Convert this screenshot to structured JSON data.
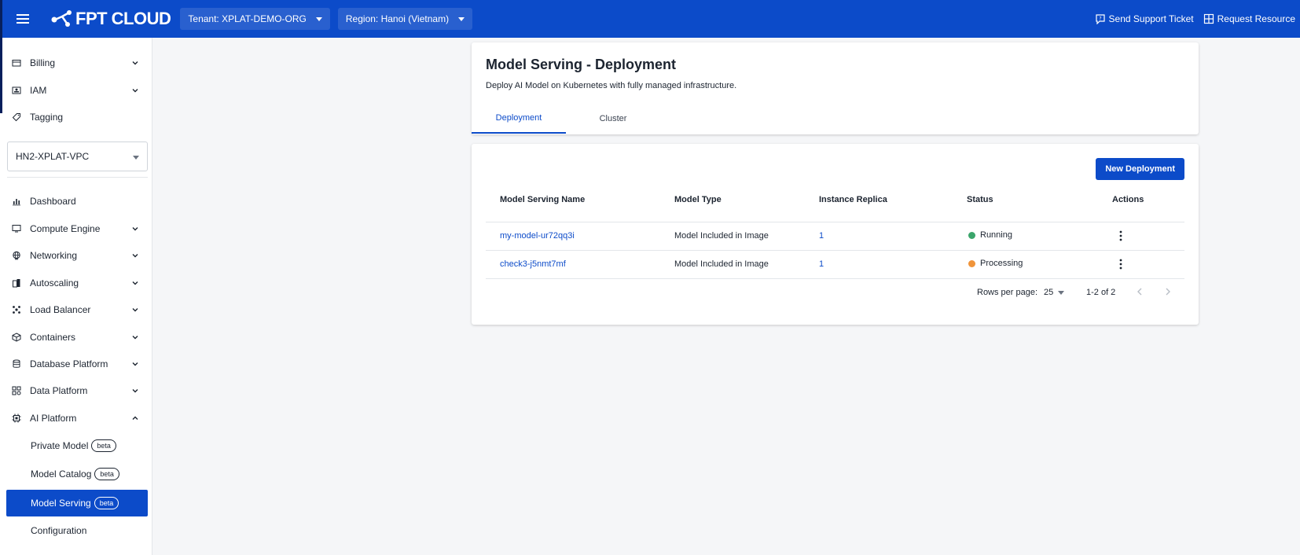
{
  "topbar": {
    "logo_text": "FPT CLOUD",
    "tenant": "Tenant: XPLAT-DEMO-ORG",
    "region": "Region: Hanoi (Vietnam)",
    "support": "Send Support Ticket",
    "request": "Request Resource"
  },
  "sidebar": {
    "top_items": [
      {
        "label": "Billing",
        "icon": "wallet-icon"
      },
      {
        "label": "IAM",
        "icon": "id-card-icon"
      },
      {
        "label": "Tagging",
        "icon": "tag-icon"
      }
    ],
    "vpc": "HN2-XPLAT-VPC",
    "items": [
      {
        "label": "Dashboard",
        "icon": "bar-chart-icon"
      },
      {
        "label": "Compute Engine",
        "icon": "monitor-icon"
      },
      {
        "label": "Networking",
        "icon": "globe-icon"
      },
      {
        "label": "Autoscaling",
        "icon": "building-icon"
      },
      {
        "label": "Load Balancer",
        "icon": "load-balancer-icon"
      },
      {
        "label": "Containers",
        "icon": "box-icon"
      },
      {
        "label": "Database Platform",
        "icon": "database-icon"
      },
      {
        "label": "Data Platform",
        "icon": "data-platform-icon"
      },
      {
        "label": "AI Platform",
        "icon": "chip-icon"
      }
    ],
    "ai_sub": [
      {
        "label": "Private Model",
        "badge": "beta"
      },
      {
        "label": "Model Catalog",
        "badge": "beta"
      },
      {
        "label": "Model Serving",
        "badge": "beta"
      },
      {
        "label": "Configuration",
        "badge": ""
      }
    ]
  },
  "page": {
    "title": "Model Serving - Deployment",
    "description": "Deploy AI Model on Kubernetes with fully managed infrastructure.",
    "tabs": [
      "Deployment",
      "Cluster"
    ],
    "new_button": "New Deployment"
  },
  "table": {
    "headers": [
      "Model Serving Name",
      "Model Type",
      "Instance Replica",
      "Status",
      "Actions"
    ],
    "rows": [
      {
        "name": "my-model-ur72qq3i",
        "type": "Model Included in Image",
        "replica": "1",
        "status": "Running",
        "status_color": "#3ba56b"
      },
      {
        "name": "check3-j5nmt7mf",
        "type": "Model Included in Image",
        "replica": "1",
        "status": "Processing",
        "status_color": "#f0943a"
      }
    ],
    "rows_per_page_label": "Rows per page:",
    "rows_per_page": "25",
    "range": "1-2 of 2"
  },
  "colors": {
    "brand": "#0c4bc9",
    "running": "#3ba56b",
    "processing": "#f0943a"
  }
}
